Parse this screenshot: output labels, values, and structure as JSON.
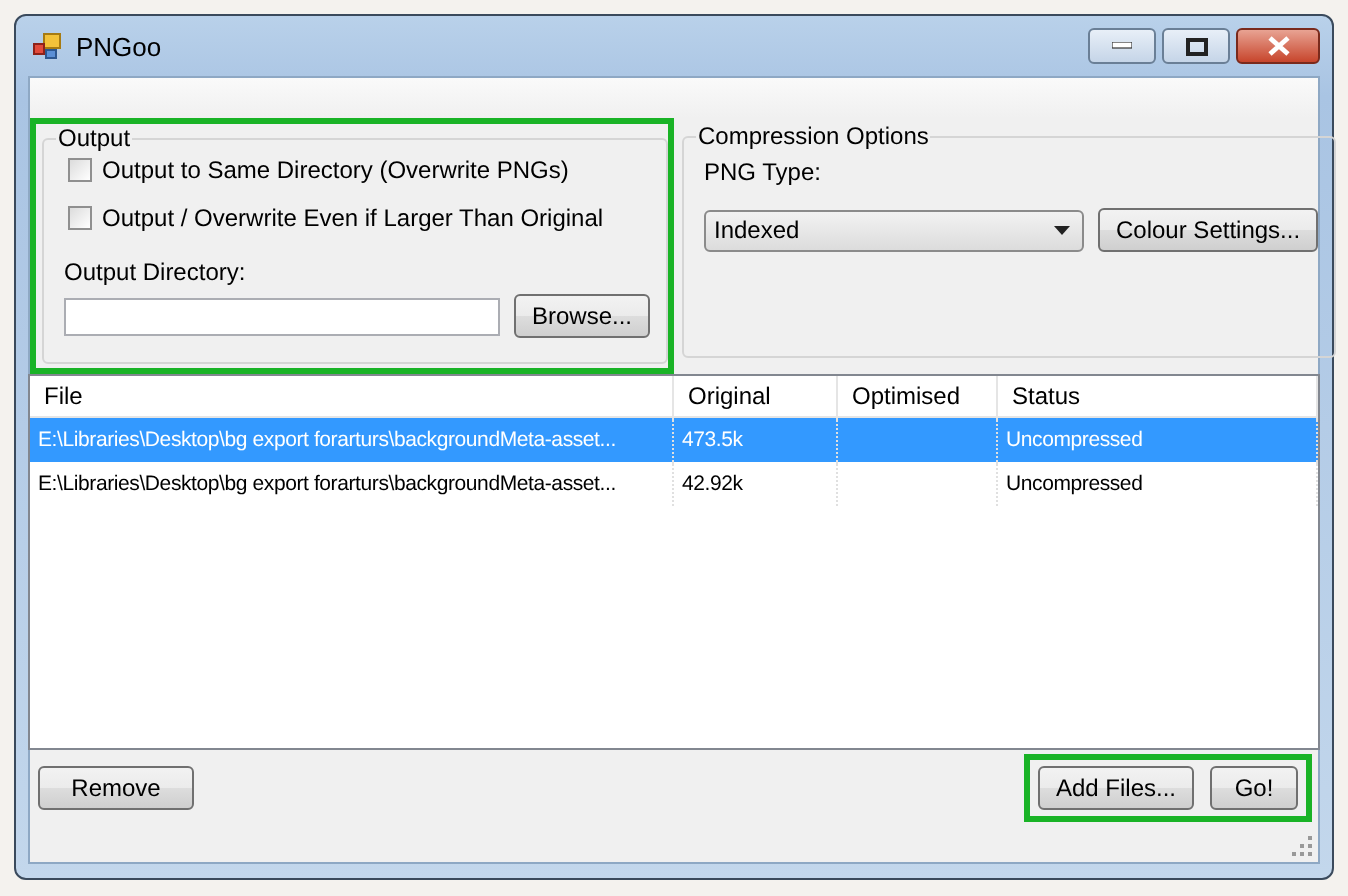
{
  "window": {
    "title": "PNGoo"
  },
  "output": {
    "title": "Output",
    "checkboxes": [
      {
        "label": "Output to Same Directory (Overwrite PNGs)",
        "checked": false
      },
      {
        "label": "Output / Overwrite Even if Larger Than Original",
        "checked": false
      }
    ],
    "directory_label": "Output Directory:",
    "browse_button": "Browse..."
  },
  "compression": {
    "title": "Compression Options",
    "png_type_label": "PNG Type:",
    "png_type": "Indexed",
    "colour_button": "Colour Settings..."
  },
  "table": {
    "columns": [
      "File",
      "Original",
      "Optimised",
      "Status"
    ],
    "rows": [
      {
        "cells": [
          "E:\\Libraries\\Desktop\\bg export forarturs\\backgroundMeta-asset...",
          "473.5k",
          "",
          "Uncompressed"
        ],
        "selected": true
      },
      {
        "cells": [
          "E:\\Libraries\\Desktop\\bg export forarturs\\backgroundMeta-asset...",
          "42.92k",
          "",
          "Uncompressed"
        ],
        "selected": false
      }
    ]
  },
  "buttons": {
    "remove": "Remove",
    "add_files": "Add Files...",
    "go": "Go!"
  }
}
